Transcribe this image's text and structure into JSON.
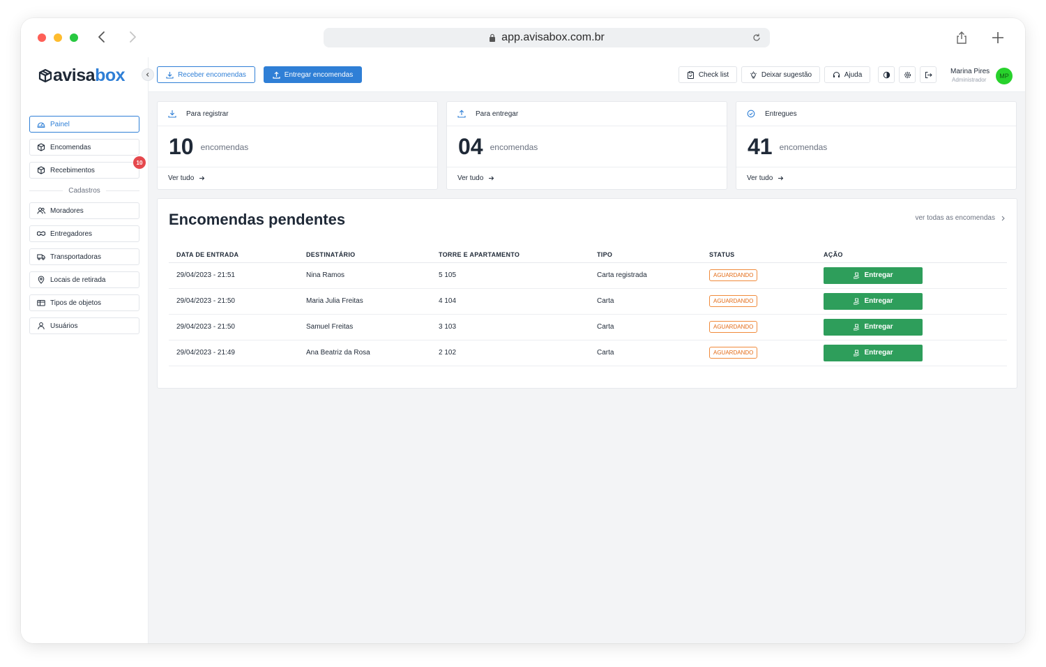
{
  "browser": {
    "url": "app.avisabox.com.br"
  },
  "brand": {
    "logo_part1": "avisa",
    "logo_part2": "box",
    "colors": {
      "primary": "#2f7fd6",
      "success": "#2e9e5b",
      "warning": "#e36b16",
      "badge": "#e5484d"
    }
  },
  "sidebar": {
    "items": [
      {
        "label": "Painel",
        "icon": "dashboard-icon",
        "active": true
      },
      {
        "label": "Encomendas",
        "icon": "package-icon"
      },
      {
        "label": "Recebimentos",
        "icon": "package-icon",
        "badge": "10"
      }
    ],
    "section_label": "Cadastros",
    "register_items": [
      {
        "label": "Moradores",
        "icon": "users-icon"
      },
      {
        "label": "Entregadores",
        "icon": "handshake-icon"
      },
      {
        "label": "Transportadoras",
        "icon": "truck-icon"
      },
      {
        "label": "Locais de retirada",
        "icon": "map-pin-icon"
      },
      {
        "label": "Tipos de objetos",
        "icon": "box-type-icon"
      },
      {
        "label": "Usuários",
        "icon": "user-icon"
      }
    ]
  },
  "topbar": {
    "receive_label": "Receber encomendas",
    "deliver_label": "Entregar encomendas",
    "checklist_label": "Check list",
    "suggestion_label": "Deixar sugestão",
    "help_label": "Ajuda",
    "user_name": "Marina Pires",
    "user_role": "Administrador",
    "user_initials": "MP"
  },
  "cards": [
    {
      "title": "Para registrar",
      "value": "10",
      "unit": "encomendas",
      "link": "Ver tudo",
      "icon": "download-icon"
    },
    {
      "title": "Para entregar",
      "value": "04",
      "unit": "encomendas",
      "link": "Ver tudo",
      "icon": "upload-icon"
    },
    {
      "title": "Entregues",
      "value": "41",
      "unit": "encomendas",
      "link": "Ver tudo",
      "icon": "check-circle-icon"
    }
  ],
  "pending": {
    "title": "Encomendas pendentes",
    "view_all": "ver todas as encomendas",
    "columns": [
      "DATA DE ENTRADA",
      "DESTINATÁRIO",
      "TORRE E APARTAMENTO",
      "TIPO",
      "STATUS",
      "AÇÃO"
    ],
    "rows": [
      {
        "date": "29/04/2023 - 21:51",
        "recipient": "Nina Ramos",
        "unit": "5 105",
        "type": "Carta registrada",
        "status": "AGUARDANDO",
        "action": "Entregar"
      },
      {
        "date": "29/04/2023 - 21:50",
        "recipient": "Maria Julia Freitas",
        "unit": "4 104",
        "type": "Carta",
        "status": "AGUARDANDO",
        "action": "Entregar"
      },
      {
        "date": "29/04/2023 - 21:50",
        "recipient": "Samuel Freitas",
        "unit": "3 103",
        "type": "Carta",
        "status": "AGUARDANDO",
        "action": "Entregar"
      },
      {
        "date": "29/04/2023 - 21:49",
        "recipient": "Ana Beatriz da Rosa",
        "unit": "2 102",
        "type": "Carta",
        "status": "AGUARDANDO",
        "action": "Entregar"
      }
    ]
  }
}
